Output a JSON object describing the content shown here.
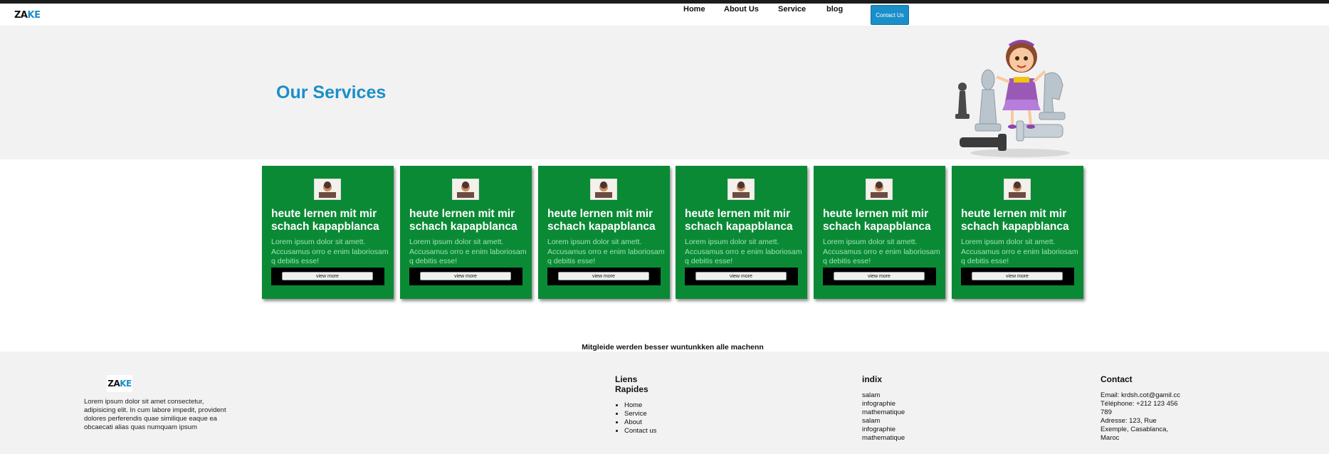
{
  "header": {
    "logo_left": "ZA",
    "logo_right": "KE",
    "nav": [
      "Home",
      "About Us",
      "Service",
      "blog"
    ],
    "contact_button": "Contact Us"
  },
  "hero": {
    "title": "Our Services"
  },
  "cards": [
    {
      "title": "heute lernen mit mir schach kapapblanca",
      "text": "Lorem ipsum dolor sit amett. Accusamus orro e enim laboriosam q debitis esse!",
      "button": "view more"
    },
    {
      "title": "heute lernen mit mir schach kapapblanca",
      "text": "Lorem ipsum dolor sit amett. Accusamus orro e enim laboriosam q debitis esse!",
      "button": "view more"
    },
    {
      "title": "heute lernen mit mir schach kapapblanca",
      "text": "Lorem ipsum dolor sit amett. Accusamus orro e enim laboriosam q debitis esse!",
      "button": "view more"
    },
    {
      "title": "heute lernen mit mir schach kapapblanca",
      "text": "Lorem ipsum dolor sit amett. Accusamus orro e enim laboriosam q debitis esse!",
      "button": "view more"
    },
    {
      "title": "heute lernen mit mir schach kapapblanca",
      "text": "Lorem ipsum dolor sit amett. Accusamus orro e enim laboriosam q debitis esse!",
      "button": "view more"
    },
    {
      "title": "heute lernen mit mir schach kapapblanca",
      "text": "Lorem ipsum dolor sit amett. Accusamus orro e enim laboriosam q debitis esse!",
      "button": "view more"
    }
  ],
  "tagline": "Mitgleide werden besser wuntunkken alle machenn",
  "footer": {
    "logo_left": "ZA",
    "logo_right": "KE",
    "about": "Lorem ipsum dolor sit amet consectetur, adipisicing elit. In cum labore impedit, provident dolores perferendis quae similique eaque ea obcaecati alias quas numquam ipsum",
    "links_title": "Liens Rapides",
    "links": [
      "Home",
      "Service",
      "About",
      "Contact us"
    ],
    "index_title": "indix",
    "index_items": [
      "salam",
      "infographie",
      "mathematique",
      "salam",
      "infographie",
      "mathematique"
    ],
    "contact_title": "Contact",
    "contact_email": "Email: krdsh.cot@gamil.cc",
    "contact_phone": "Téléphone: +212 123 456 789",
    "contact_address": "Adresse: 123, Rue Exemple, Casablanca, Maroc"
  },
  "colors": {
    "accent": "#1a8fc9",
    "card_green": "#0b8a36",
    "hero_bg": "#f2f2f2"
  },
  "icons": {
    "hero": "girl-with-chess-pieces-illustration",
    "card": "chess-player-thumbnail"
  }
}
